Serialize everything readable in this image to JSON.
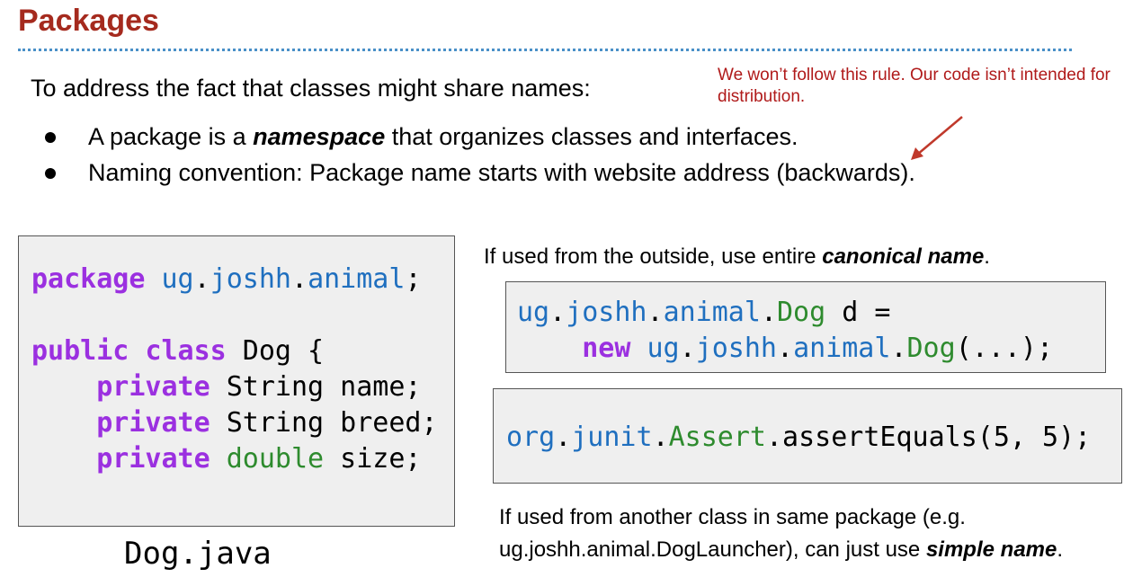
{
  "slide": {
    "title": "Packages",
    "intro": "To address the fact that classes might share names:",
    "note": "We won’t follow this rule. Our code isn’t intended for distribution.",
    "bullets": [
      {
        "pre": "A package is a ",
        "em": "namespace",
        "post": " that organizes classes and interfaces."
      },
      {
        "pre": "Naming convention: Package name starts with website address (backwards).",
        "em": "",
        "post": ""
      }
    ],
    "canonical_text_pre": "If used from the outside, use entire ",
    "canonical_text_em": "canonical name",
    "canonical_text_post": ".",
    "simple_text_pre": "If used from another class in same package (e.g. ug.joshh.animal.DogLauncher), can just use ",
    "simple_text_em": "simple name",
    "simple_text_post": ".",
    "filename": "Dog.java",
    "colors": {
      "title": "#a52a1e",
      "note": "#b01a1a",
      "keyword": "#9b30e0",
      "package": "#1f6fbf",
      "type": "#2e8b2e"
    }
  },
  "code_dog": {
    "l1_kw": "package",
    "l1_pkg_a": "ug",
    "l1_dot1": ".",
    "l1_pkg_b": "joshh",
    "l1_dot2": ".",
    "l1_pkg_c": "animal",
    "l1_end": ";",
    "l3_kw1": "public",
    "l3_kw2": "class",
    "l3_rest": " Dog {",
    "l4_kw": "private",
    "l4_rest": " String name;",
    "l5_kw": "private",
    "l5_rest": " String breed;",
    "l6_kw": "private",
    "l6_ty": "double",
    "l6_rest": " size;"
  },
  "code_canon": {
    "a1": "ug",
    "d1": ".",
    "a2": "joshh",
    "d2": ".",
    "a3": "animal",
    "d3": ".",
    "cls1": "Dog",
    "r1": " d =",
    "kw": "new",
    "b1": "ug",
    "d4": ".",
    "b2": "joshh",
    "d5": ".",
    "b3": "animal",
    "d6": ".",
    "cls2": "Dog",
    "r2": "(...);"
  },
  "code_junit": {
    "p1": "org",
    "d1": ".",
    "p2": "junit",
    "d2": ".",
    "cls": "Assert",
    "rest": ".assertEquals(5, 5);"
  }
}
